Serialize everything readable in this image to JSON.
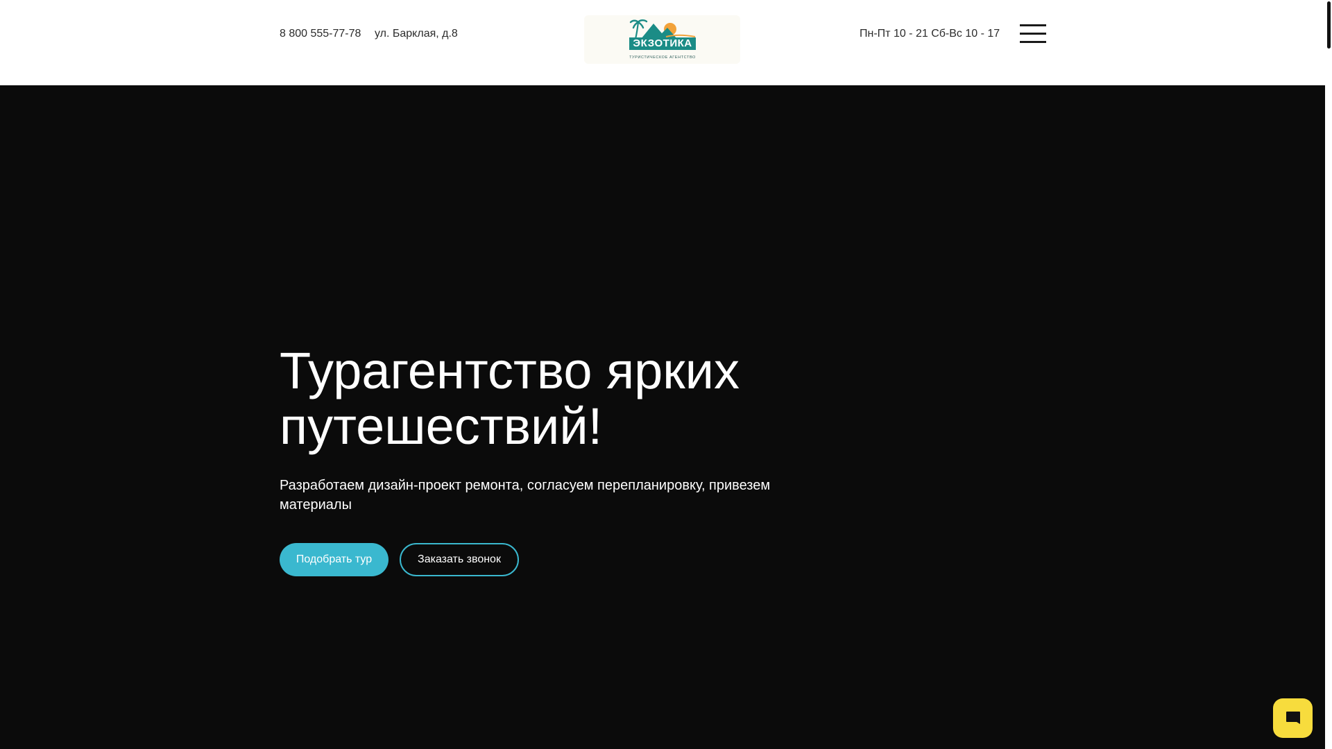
{
  "header": {
    "phone": "8 800 555-77-78",
    "address": "ул. Барклая, д.8",
    "hours": "Пн-Пт 10 - 21 Сб-Вс 10 - 17",
    "logo": {
      "title": "ЭКЗОТИКА",
      "subtitle": "ТУРИСТИЧЕСКОЕ АГЕНТСТВО"
    },
    "menu_icon": "hamburger-icon"
  },
  "hero": {
    "title_line1": "Турагентство ярких",
    "title_line2": "путешествий!",
    "subtitle": "Разработаем дизайн-проект ремонта, согласуем перепланировку, привезем материалы",
    "primary_button": "Подобрать тур",
    "secondary_button": "Заказать звонок"
  },
  "chat": {
    "icon": "chat-bubble-icon"
  },
  "colors": {
    "accent": "#3ab8cf",
    "hero_background": "#0b0b0b",
    "chat_widget": "#f7dc3d",
    "logo_teal": "#1b8c86",
    "logo_orange": "#f2a23a"
  }
}
